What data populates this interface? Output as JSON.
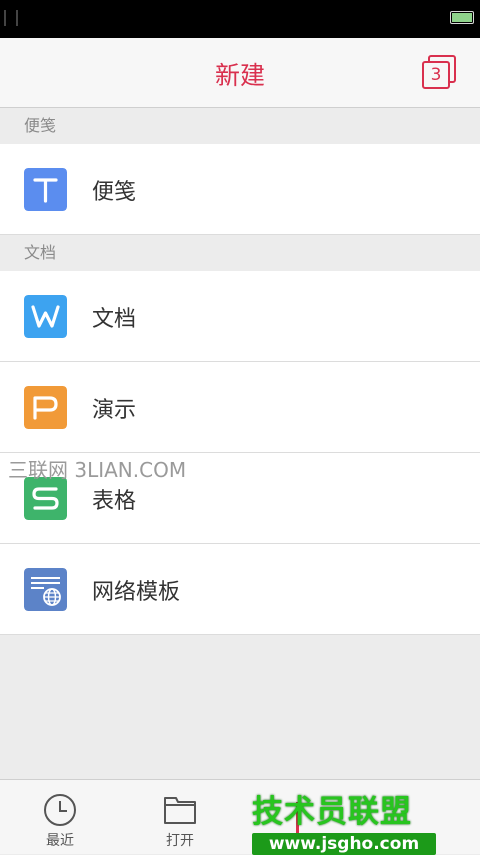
{
  "header": {
    "title": "新建",
    "tabs_count": "3"
  },
  "sections": [
    {
      "title": "便笺",
      "items": [
        {
          "label": "便笺",
          "icon": "note-t-icon",
          "color": "#5b8def"
        }
      ]
    },
    {
      "title": "文档",
      "items": [
        {
          "label": "文档",
          "icon": "writer-w-icon",
          "color": "#3da3f0"
        },
        {
          "label": "演示",
          "icon": "presentation-p-icon",
          "color": "#f19a38"
        },
        {
          "label": "表格",
          "icon": "spreadsheet-s-icon",
          "color": "#3eb46b"
        },
        {
          "label": "网络模板",
          "icon": "web-template-icon",
          "color": "#5c83c8"
        }
      ]
    }
  ],
  "watermark1": "三联网 3LIAN.COM",
  "bottom_nav": [
    {
      "label": "最近",
      "icon": "clock-icon"
    },
    {
      "label": "打开",
      "icon": "folder-icon"
    }
  ],
  "watermark2": {
    "brand": "技术员联盟",
    "url": "www.jsgho.com"
  },
  "colors": {
    "accent": "#d9304e"
  }
}
